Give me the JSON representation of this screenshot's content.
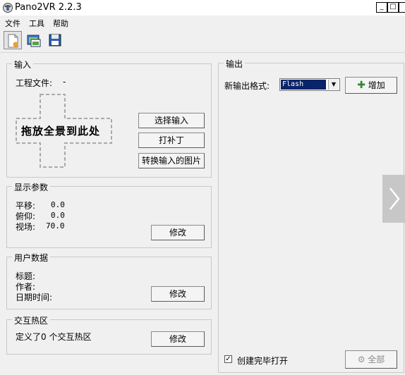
{
  "window": {
    "title": "Pano2VR 2.2.3",
    "controls": {
      "minimize": "_",
      "maximize": "□",
      "close": "X"
    }
  },
  "menu": [
    "文件",
    "工具",
    "帮助"
  ],
  "toolbar": [
    "new-project-icon",
    "open-project-icon",
    "save-project-icon"
  ],
  "input_panel": {
    "legend": "输入",
    "project_file_label": "工程文件:",
    "project_file_value": "-",
    "drop_text": "拖放全景到此处",
    "buttons": [
      "选择输入",
      "打补丁",
      "转换输入的图片"
    ]
  },
  "display_params": {
    "legend": "显示参数",
    "rows": [
      {
        "label": "平移:",
        "value": "0.0"
      },
      {
        "label": "俯仰:",
        "value": "0.0"
      },
      {
        "label": "视场:",
        "value": "70.0"
      }
    ],
    "modify_button": "修改"
  },
  "user_data": {
    "legend": "用户数据",
    "rows": [
      "标题:",
      "作者:",
      "日期时间:"
    ],
    "modify_button": "修改"
  },
  "hotspots": {
    "legend": "交互热区",
    "summary": "定义了0 个交互热区",
    "modify_button": "修改"
  },
  "output_panel": {
    "legend": "输出",
    "new_format_label": "新输出格式:",
    "format_value": "Flash",
    "add_button": "增加",
    "open_when_done_label": "创建完毕打开",
    "open_when_done_checked": true,
    "all_button": "全部"
  },
  "overlay": {
    "next_icon": "chevron-right-icon"
  }
}
